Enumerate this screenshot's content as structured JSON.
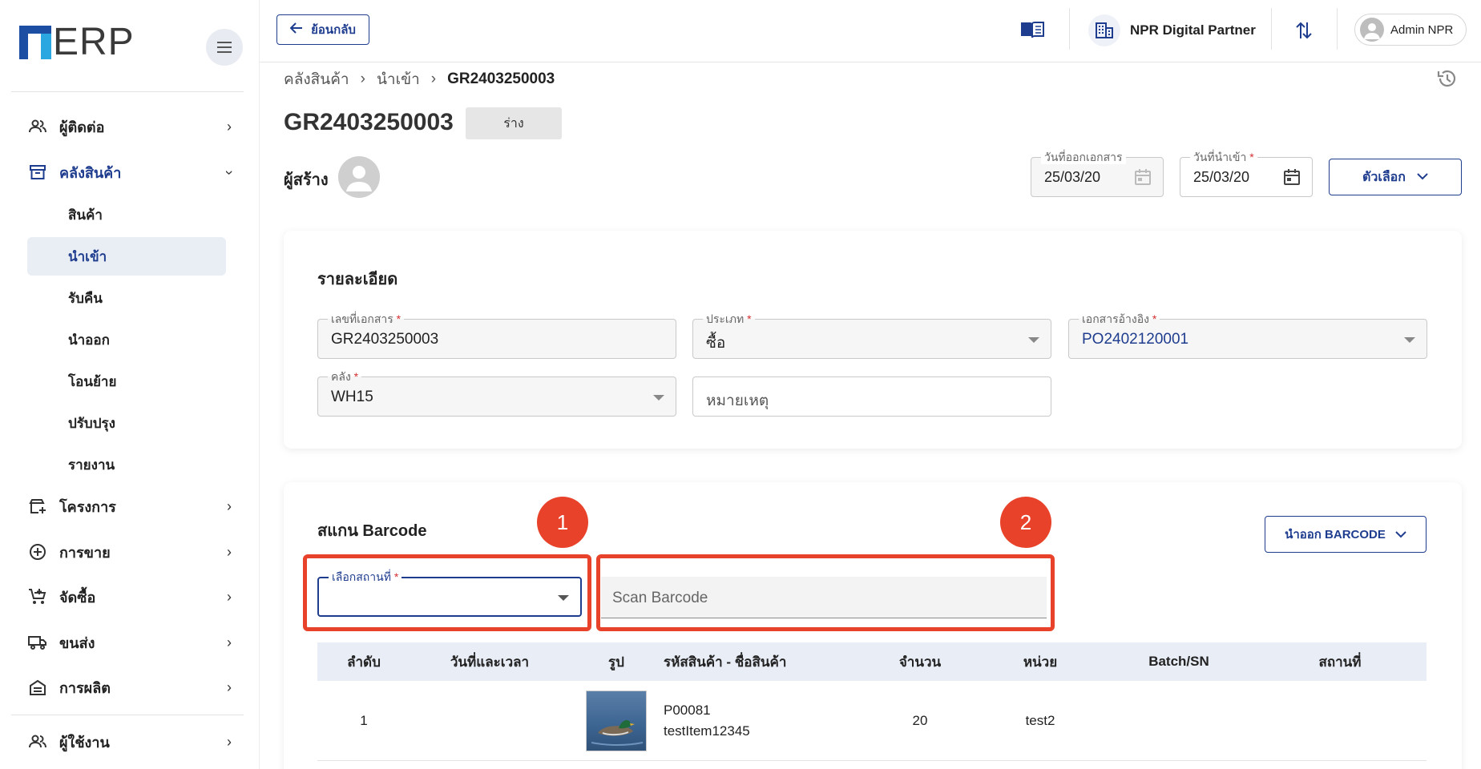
{
  "logo": {
    "text": "ERP"
  },
  "sidebar": {
    "items": [
      {
        "label": "ผู้ติดต่อ",
        "icon": "contacts-icon"
      },
      {
        "label": "คลังสินค้า",
        "icon": "warehouse-icon"
      },
      {
        "label": "โครงการ",
        "icon": "project-icon"
      },
      {
        "label": "การขาย",
        "icon": "sales-icon"
      },
      {
        "label": "จัดซื้อ",
        "icon": "cart-icon"
      },
      {
        "label": "ขนส่ง",
        "icon": "truck-icon"
      },
      {
        "label": "การผลิต",
        "icon": "factory-icon"
      },
      {
        "label": "ผู้ใช้งาน",
        "icon": "users-icon"
      }
    ],
    "subitems": [
      "สินค้า",
      "นำเข้า",
      "รับคืน",
      "นำออก",
      "โอนย้าย",
      "ปรับปรุง",
      "รายงาน"
    ]
  },
  "topbar": {
    "back_label": "ย้อนกลับ",
    "company": "NPR Digital Partner",
    "user": "Admin NPR"
  },
  "breadcrumb": [
    "คลังสินค้า",
    "นำเข้า",
    "GR2403250003"
  ],
  "document": {
    "number": "GR2403250003",
    "status": "ร่าง",
    "creator_label": "ผู้สร้าง",
    "issue_date_label": "วันที่ออกเอกสาร",
    "issue_date": "25/03/20",
    "import_date_label": "วันที่นำเข้า",
    "import_date": "25/03/20",
    "options_label": "ตัวเลือก"
  },
  "details": {
    "title": "รายละเอียด",
    "doc_no_label": "เลขที่เอกสาร",
    "doc_no": "GR2403250003",
    "type_label": "ประเภท",
    "type": "ซื้อ",
    "ref_label": "เอกสารอ้างอิง",
    "ref": "PO2402120001",
    "warehouse_label": "คลัง",
    "warehouse": "WH15",
    "remark_placeholder": "หมายเหตุ"
  },
  "scan": {
    "title": "สแกน Barcode",
    "export_label": "นำออก BARCODE",
    "location_label": "เลือกสถานที่",
    "barcode_placeholder": "Scan Barcode",
    "badge1": "1",
    "badge2": "2",
    "highlight_color": "#e8432a"
  },
  "table": {
    "headers": [
      "ลำดับ",
      "วันที่และเวลา",
      "รูป",
      "รหัสสินค้า - ชื่อสินค้า",
      "จำนวน",
      "หน่วย",
      "Batch/SN",
      "สถานที่"
    ],
    "rows": [
      {
        "no": "1",
        "datetime": "",
        "code": "P00081",
        "name": "testItem12345",
        "qty": "20",
        "unit": "test2",
        "batch": "",
        "location": ""
      }
    ]
  },
  "colors": {
    "primary": "#1f3d8f",
    "accent": "#2aa7e0",
    "highlight": "#e8432a"
  }
}
